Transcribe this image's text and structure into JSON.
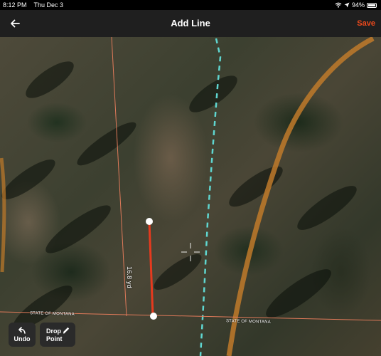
{
  "status_bar": {
    "time": "8:12 PM",
    "date": "Thu Dec 3",
    "battery": "94%",
    "icons": [
      "wifi-icon",
      "location-arrow-icon",
      "battery-icon"
    ]
  },
  "nav": {
    "title": "Add Line",
    "save_label": "Save",
    "back_icon": "arrow-left-icon"
  },
  "map": {
    "boundary_labels": [
      "STATE OF MONTANA",
      "STATE OF MONTANA"
    ],
    "measurement_label": "16.8 yd",
    "crosshair_icon": "crosshair-icon",
    "colors": {
      "drawn_line": "#e63a1e",
      "boundary_line": "#e07a5a",
      "trail_dashed": "#5fd6d0",
      "road": "#c07a2a"
    }
  },
  "toolbar": {
    "undo_label": "Undo",
    "drop_point_label_line1": "Drop",
    "drop_point_label_line2": "Point"
  }
}
